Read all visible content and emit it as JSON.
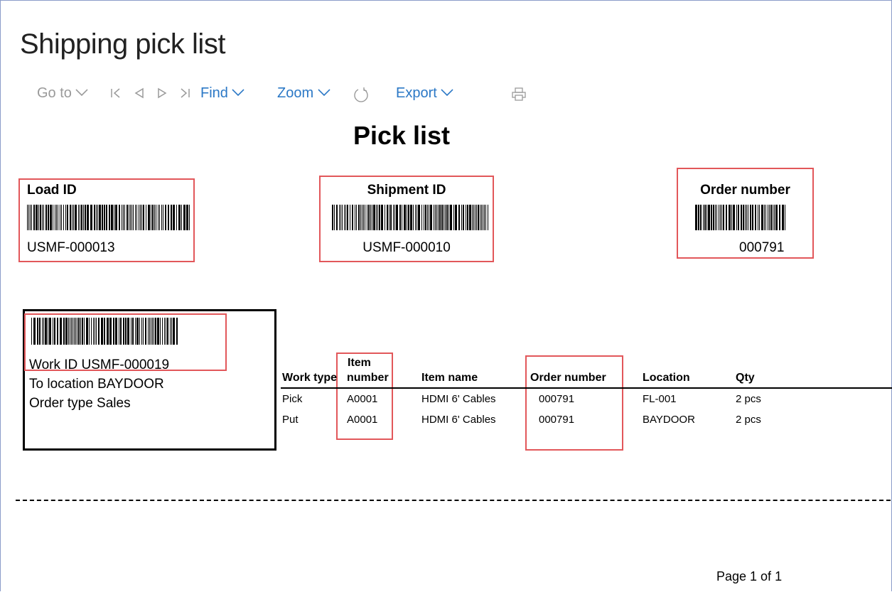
{
  "window": {
    "title": "Shipping pick list"
  },
  "toolbar": {
    "goto_label": "Go to",
    "find_label": "Find",
    "zoom_label": "Zoom",
    "export_label": "Export",
    "icons": [
      "chevron-down-icon",
      "first-page-icon",
      "previous-page-icon",
      "next-page-icon",
      "last-page-icon",
      "refresh-icon",
      "print-icon"
    ],
    "link_color": "#2b78c6",
    "disabled_color": "#9a9a9a"
  },
  "report": {
    "title": "Pick list",
    "load": {
      "label": "Load ID",
      "value": "USMF-000013"
    },
    "shipment": {
      "label": "Shipment ID",
      "value": "USMF-000010"
    },
    "order": {
      "label": "Order number",
      "value": "000791"
    },
    "work": {
      "id_line": "Work ID USMF-000019",
      "location_line": "To location BAYDOOR",
      "order_type_line": "Order type Sales"
    },
    "table": {
      "headers": {
        "work_type": "Work type",
        "item_number_1": "Item",
        "item_number_2": "number",
        "item_name": "Item name",
        "order_number": "Order number",
        "location": "Location",
        "qty": "Qty"
      },
      "rows": [
        {
          "work_type": "Pick",
          "item_number": "A0001",
          "item_name": "HDMI 6' Cables",
          "order_number": "000791",
          "location": "FL-001",
          "qty": "2 pcs"
        },
        {
          "work_type": "Put",
          "item_number": "A0001",
          "item_name": "HDMI 6' Cables",
          "order_number": "000791",
          "location": "BAYDOOR",
          "qty": "2 pcs"
        }
      ]
    },
    "highlight_color": "#e2575a",
    "pager": "Page 1 of 1"
  }
}
